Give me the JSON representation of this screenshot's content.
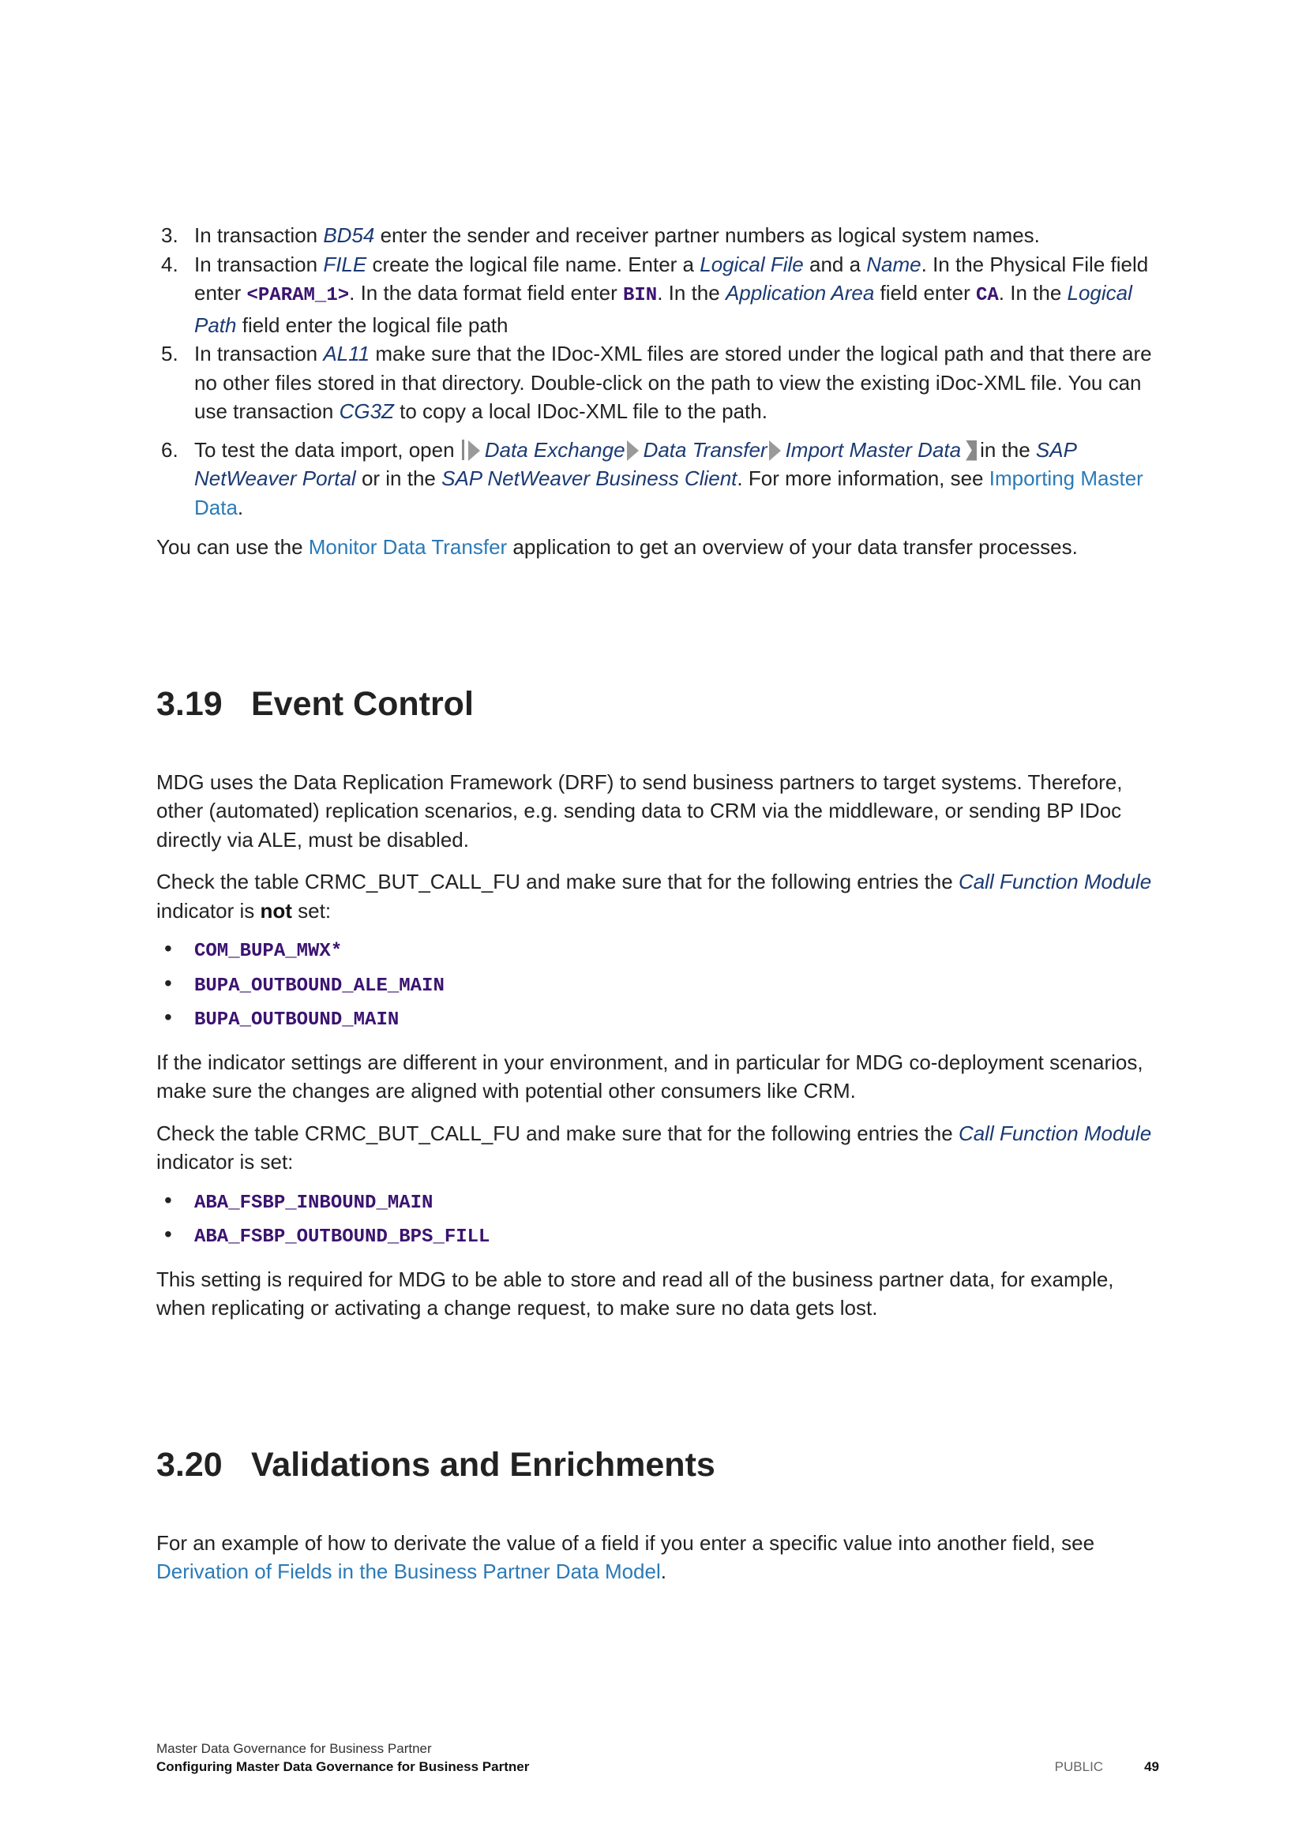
{
  "steps": [
    {
      "num": "3.",
      "parts": [
        {
          "t": "In transaction "
        },
        {
          "t": "BD54",
          "s": "i"
        },
        {
          "t": " enter the sender and receiver partner numbers as logical system names."
        }
      ]
    },
    {
      "num": "4.",
      "parts": [
        {
          "t": "In transaction "
        },
        {
          "t": "FILE",
          "s": "i"
        },
        {
          "t": " create the logical file name. Enter a "
        },
        {
          "t": "Logical File",
          "s": "i"
        },
        {
          "t": " and a "
        },
        {
          "t": "Name",
          "s": "i"
        },
        {
          "t": ". In the Physical File field enter "
        },
        {
          "t": "<PARAM_1>",
          "s": "cd"
        },
        {
          "t": ". In the data format field enter "
        },
        {
          "t": "BIN",
          "s": "cd"
        },
        {
          "t": ". In the "
        },
        {
          "t": "Application Area",
          "s": "i"
        },
        {
          "t": " field enter "
        },
        {
          "t": "CA",
          "s": "cd"
        },
        {
          "t": ". In the "
        },
        {
          "t": "Logical Path",
          "s": "i"
        },
        {
          "t": " field enter the logical file path"
        }
      ]
    },
    {
      "num": "5.",
      "parts": [
        {
          "t": "In transaction "
        },
        {
          "t": "AL11",
          "s": "i"
        },
        {
          "t": " make sure that the IDoc-XML files are stored under the logical path and that there are no other files stored in that directory. Double-click on the path to view the existing iDoc-XML file. You can use transaction "
        },
        {
          "t": "CG3Z",
          "s": "i"
        },
        {
          "t": " to copy a local IDoc-XML file to the path."
        }
      ]
    },
    {
      "num": "6.",
      "parts": [
        {
          "t": "To test the data import, open "
        },
        {
          "s": "path-start"
        },
        {
          "s": "arrow"
        },
        {
          "t": "Data Exchange",
          "s": "i"
        },
        {
          "s": "arrow"
        },
        {
          "t": "Data Transfer",
          "s": "i"
        },
        {
          "s": "arrow"
        },
        {
          "t": "Import Master Data",
          "s": "i"
        },
        {
          "s": "path-end"
        },
        {
          "t": "in the "
        },
        {
          "t": "SAP NetWeaver Portal",
          "s": "i"
        },
        {
          "t": " or in the "
        },
        {
          "t": "SAP NetWeaver Business Client",
          "s": "i"
        },
        {
          "t": ". For more information, see "
        },
        {
          "t": "Importing Master Data",
          "s": "lk"
        },
        {
          "t": "."
        }
      ]
    }
  ],
  "monitor_para": {
    "before": "You can use the ",
    "link": "Monitor Data Transfer",
    "after": " application to get an overview of your data transfer processes."
  },
  "section_319": {
    "number": "3.19",
    "title": "Event Control",
    "p1": "MDG uses the Data Replication Framework (DRF) to send business partners to target systems. Therefore, other (automated) replication scenarios, e.g. sending data to CRM via the middleware, or sending BP IDoc directly via ALE, must be disabled.",
    "p2_before": "Check the table CRMC_BUT_CALL_FU and make sure that for the following entries the ",
    "p2_italic": "Call Function Module",
    "p2_mid": " indicator is ",
    "p2_bold": "not",
    "p2_after": " set:",
    "codes1": [
      "COM_BUPA_MWX*",
      "BUPA_OUTBOUND_ALE_MAIN",
      "BUPA_OUTBOUND_MAIN"
    ],
    "p3": "If the indicator settings are different in your environment, and in particular for MDG co-deployment scenarios, make sure the changes are aligned with potential other consumers like CRM.",
    "p4_before": "Check the table CRMC_BUT_CALL_FU and make sure that for the following entries the ",
    "p4_italic": "Call Function Module",
    "p4_after": " indicator is set:",
    "codes2": [
      "ABA_FSBP_INBOUND_MAIN",
      "ABA_FSBP_OUTBOUND_BPS_FILL"
    ],
    "p5": "This setting is required for MDG to be able to store and read all of the business partner data, for example, when replicating or activating a change request, to make sure no data gets lost."
  },
  "section_320": {
    "number": "3.20",
    "title": "Validations and Enrichments",
    "p1_before": "For an example of how to derivate the value of a field if you enter a specific value into another field, see ",
    "p1_link": "Derivation of Fields in the Business Partner Data Model",
    "p1_after": "."
  },
  "footer": {
    "line1": "Master Data Governance for Business Partner",
    "line2": "Configuring Master Data Governance for Business Partner",
    "classification": "PUBLIC",
    "page": "49"
  }
}
